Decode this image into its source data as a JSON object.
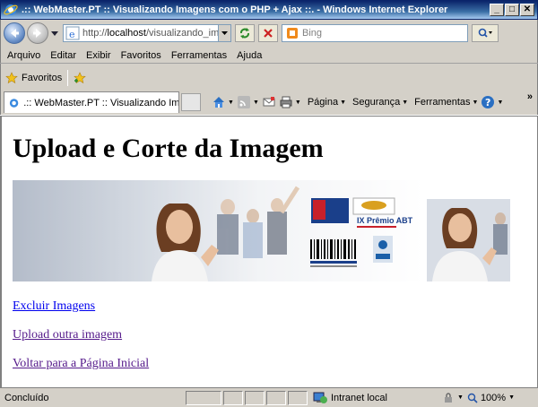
{
  "window": {
    "title": ".:: WebMaster.PT :: Visualizando Imagens com o PHP + Ajax ::. - Windows Internet Explorer"
  },
  "address": {
    "url_prefix": "http://",
    "url_host": "localhost",
    "url_path": "/visualizando_imag"
  },
  "search": {
    "placeholder": "Bing"
  },
  "menu": {
    "items": [
      {
        "label": "Arquivo"
      },
      {
        "label": "Editar"
      },
      {
        "label": "Exibir"
      },
      {
        "label": "Favoritos"
      },
      {
        "label": "Ferramentas"
      },
      {
        "label": "Ajuda"
      }
    ]
  },
  "favorites": {
    "label": "Favoritos"
  },
  "tab": {
    "title": ".:: WebMaster.PT :: Visualizando Im..."
  },
  "commands": {
    "pagina": "Página",
    "seguranca": "Segurança",
    "ferramentas": "Ferramentas"
  },
  "page": {
    "heading": "Upload e Corte da Imagem",
    "links": {
      "excluir": "Excluir Imagens",
      "upload": "Upload outra imagem",
      "voltar": "Voltar para a Página Inicial"
    },
    "banner_labels": {
      "prize": "IX Prêmio ABT"
    }
  },
  "status": {
    "text": "Concluído",
    "zone": "Intranet local",
    "zoom": "100%"
  },
  "colors": {
    "titlebar": "#0a246a",
    "link": "#0000ee",
    "visited": "#551a8b",
    "chrome": "#d4d0c8"
  }
}
